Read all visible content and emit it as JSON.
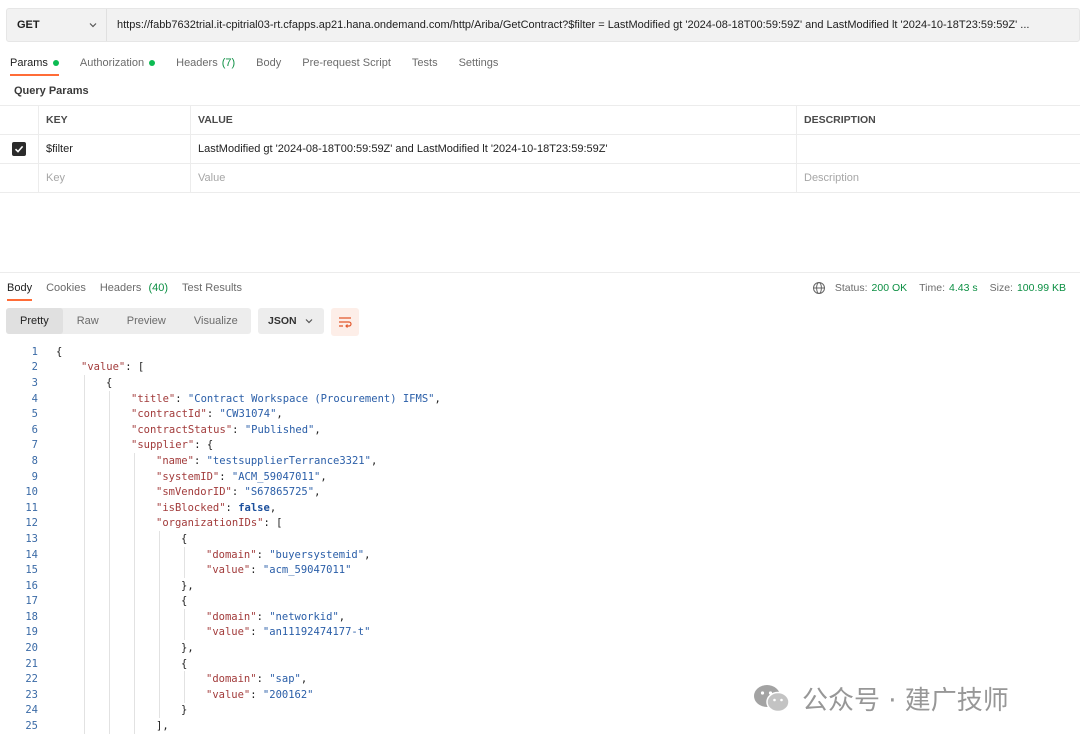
{
  "request": {
    "method": "GET",
    "url": "https://fabb7632trial.it-cpitrial03-rt.cfapps.ap21.hana.ondemand.com/http/Ariba/GetContract?$filter = LastModified gt '2024-08-18T00:59:59Z' and LastModified lt '2024-10-18T23:59:59Z' ..."
  },
  "request_tabs": [
    {
      "label": "Params",
      "dot": true
    },
    {
      "label": "Authorization",
      "dot": true
    },
    {
      "label": "Headers",
      "count": "(7)"
    },
    {
      "label": "Body"
    },
    {
      "label": "Pre-request Script"
    },
    {
      "label": "Tests"
    },
    {
      "label": "Settings"
    }
  ],
  "query_params": {
    "section_label": "Query Params",
    "headers": {
      "key": "KEY",
      "value": "VALUE",
      "description": "DESCRIPTION"
    },
    "rows": [
      {
        "key": "$filter",
        "value": "LastModified gt '2024-08-18T00:59:59Z' and LastModified lt '2024-10-18T23:59:59Z'",
        "description": ""
      }
    ],
    "placeholders": {
      "key": "Key",
      "value": "Value",
      "description": "Description"
    }
  },
  "response_tabs": [
    {
      "label": "Body"
    },
    {
      "label": "Cookies"
    },
    {
      "label": "Headers",
      "count": "(40)"
    },
    {
      "label": "Test Results"
    }
  ],
  "status": {
    "status_label": "Status:",
    "status_value": "200 OK",
    "time_label": "Time:",
    "time_value": "4.43 s",
    "size_label": "Size:",
    "size_value": "100.99 KB"
  },
  "view_modes": [
    "Pretty",
    "Raw",
    "Preview",
    "Visualize"
  ],
  "format": "JSON",
  "code_lines": [
    {
      "n": "1",
      "indent": 0,
      "parts": [
        [
          "p",
          "{"
        ]
      ]
    },
    {
      "n": "2",
      "indent": 1,
      "parts": [
        [
          "k",
          "\"value\""
        ],
        [
          "p",
          ": ["
        ]
      ]
    },
    {
      "n": "3",
      "indent": 2,
      "parts": [
        [
          "p",
          "{"
        ]
      ]
    },
    {
      "n": "4",
      "indent": 3,
      "parts": [
        [
          "k",
          "\"title\""
        ],
        [
          "p",
          ": "
        ],
        [
          "s",
          "\"Contract Workspace (Procurement) IFMS\""
        ],
        [
          "p",
          ","
        ]
      ]
    },
    {
      "n": "5",
      "indent": 3,
      "parts": [
        [
          "k",
          "\"contractId\""
        ],
        [
          "p",
          ": "
        ],
        [
          "s",
          "\"CW31074\""
        ],
        [
          "p",
          ","
        ]
      ]
    },
    {
      "n": "6",
      "indent": 3,
      "parts": [
        [
          "k",
          "\"contractStatus\""
        ],
        [
          "p",
          ": "
        ],
        [
          "s",
          "\"Published\""
        ],
        [
          "p",
          ","
        ]
      ]
    },
    {
      "n": "7",
      "indent": 3,
      "parts": [
        [
          "k",
          "\"supplier\""
        ],
        [
          "p",
          ": {"
        ]
      ]
    },
    {
      "n": "8",
      "indent": 4,
      "parts": [
        [
          "k",
          "\"name\""
        ],
        [
          "p",
          ": "
        ],
        [
          "s",
          "\"testsupplierTerrance3321\""
        ],
        [
          "p",
          ","
        ]
      ]
    },
    {
      "n": "9",
      "indent": 4,
      "parts": [
        [
          "k",
          "\"systemID\""
        ],
        [
          "p",
          ": "
        ],
        [
          "s",
          "\"ACM_59047011\""
        ],
        [
          "p",
          ","
        ]
      ]
    },
    {
      "n": "10",
      "indent": 4,
      "parts": [
        [
          "k",
          "\"smVendorID\""
        ],
        [
          "p",
          ": "
        ],
        [
          "s",
          "\"S67865725\""
        ],
        [
          "p",
          ","
        ]
      ]
    },
    {
      "n": "11",
      "indent": 4,
      "parts": [
        [
          "k",
          "\"isBlocked\""
        ],
        [
          "p",
          ": "
        ],
        [
          "b",
          "false"
        ],
        [
          "p",
          ","
        ]
      ]
    },
    {
      "n": "12",
      "indent": 4,
      "parts": [
        [
          "k",
          "\"organizationIDs\""
        ],
        [
          "p",
          ": ["
        ]
      ]
    },
    {
      "n": "13",
      "indent": 5,
      "parts": [
        [
          "p",
          "{"
        ]
      ]
    },
    {
      "n": "14",
      "indent": 6,
      "parts": [
        [
          "k",
          "\"domain\""
        ],
        [
          "p",
          ": "
        ],
        [
          "s",
          "\"buyersystemid\""
        ],
        [
          "p",
          ","
        ]
      ]
    },
    {
      "n": "15",
      "indent": 6,
      "parts": [
        [
          "k",
          "\"value\""
        ],
        [
          "p",
          ": "
        ],
        [
          "s",
          "\"acm_59047011\""
        ]
      ]
    },
    {
      "n": "16",
      "indent": 5,
      "parts": [
        [
          "p",
          "},"
        ]
      ]
    },
    {
      "n": "17",
      "indent": 5,
      "parts": [
        [
          "p",
          "{"
        ]
      ]
    },
    {
      "n": "18",
      "indent": 6,
      "parts": [
        [
          "k",
          "\"domain\""
        ],
        [
          "p",
          ": "
        ],
        [
          "s",
          "\"networkid\""
        ],
        [
          "p",
          ","
        ]
      ]
    },
    {
      "n": "19",
      "indent": 6,
      "parts": [
        [
          "k",
          "\"value\""
        ],
        [
          "p",
          ": "
        ],
        [
          "s",
          "\"an11192474177-t\""
        ]
      ]
    },
    {
      "n": "20",
      "indent": 5,
      "parts": [
        [
          "p",
          "},"
        ]
      ]
    },
    {
      "n": "21",
      "indent": 5,
      "parts": [
        [
          "p",
          "{"
        ]
      ]
    },
    {
      "n": "22",
      "indent": 6,
      "parts": [
        [
          "k",
          "\"domain\""
        ],
        [
          "p",
          ": "
        ],
        [
          "s",
          "\"sap\""
        ],
        [
          "p",
          ","
        ]
      ]
    },
    {
      "n": "23",
      "indent": 6,
      "parts": [
        [
          "k",
          "\"value\""
        ],
        [
          "p",
          ": "
        ],
        [
          "s",
          "\"200162\""
        ]
      ]
    },
    {
      "n": "24",
      "indent": 5,
      "parts": [
        [
          "p",
          "}"
        ]
      ]
    },
    {
      "n": "25",
      "indent": 4,
      "parts": [
        [
          "p",
          "],"
        ]
      ]
    }
  ],
  "watermark": {
    "text": "公众号 · 建广技师",
    "icon": "wechat-icon"
  },
  "colors": {
    "accent": "#ff6c37",
    "success": "#0c8f43",
    "dot": "#0cbb52",
    "json_key": "#a23b3b",
    "json_string": "#2a5ea8"
  }
}
